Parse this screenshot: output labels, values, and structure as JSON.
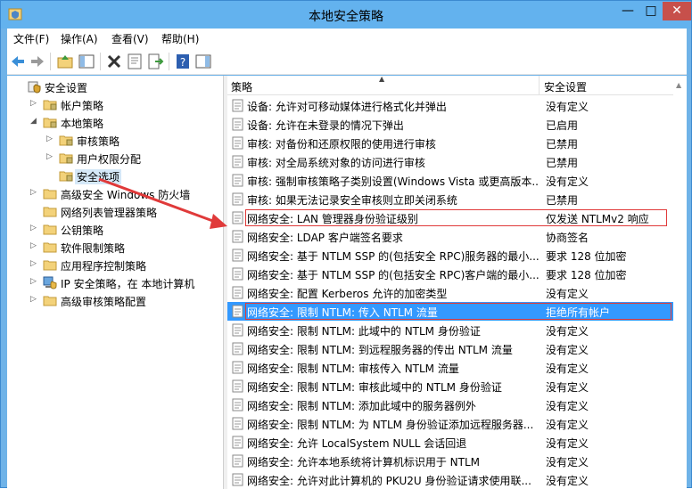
{
  "window": {
    "title": "本地安全策略"
  },
  "menu": [
    "文件(F)",
    "操作(A)",
    "查看(V)",
    "帮助(H)"
  ],
  "tree": [
    {
      "label": "安全设置",
      "level": 0,
      "twisty": "",
      "icon": "folder-shield-icon"
    },
    {
      "label": "帐户策略",
      "level": 1,
      "twisty": "▷",
      "icon": "folder-icon"
    },
    {
      "label": "本地策略",
      "level": 1,
      "twisty": "◢",
      "icon": "folder-icon"
    },
    {
      "label": "审核策略",
      "level": 2,
      "twisty": "▷",
      "icon": "folder-icon"
    },
    {
      "label": "用户权限分配",
      "level": 2,
      "twisty": "▷",
      "icon": "folder-icon"
    },
    {
      "label": "安全选项",
      "level": 2,
      "twisty": "",
      "icon": "folder-icon",
      "selected": true
    },
    {
      "label": "高级安全 Windows 防火墙",
      "level": 1,
      "twisty": "▷",
      "icon": "folder-icon"
    },
    {
      "label": "网络列表管理器策略",
      "level": 1,
      "twisty": "",
      "icon": "folder-icon"
    },
    {
      "label": "公钥策略",
      "level": 1,
      "twisty": "▷",
      "icon": "folder-icon"
    },
    {
      "label": "软件限制策略",
      "level": 1,
      "twisty": "▷",
      "icon": "folder-icon"
    },
    {
      "label": "应用程序控制策略",
      "level": 1,
      "twisty": "▷",
      "icon": "folder-icon"
    },
    {
      "label": "IP 安全策略，在 本地计算机",
      "level": 1,
      "twisty": "▷",
      "icon": "ip-security-icon"
    },
    {
      "label": "高级审核策略配置",
      "level": 1,
      "twisty": "▷",
      "icon": "folder-icon"
    }
  ],
  "list": {
    "columns": [
      "策略",
      "安全设置"
    ],
    "rows": [
      {
        "policy": "设备: 允许对可移动媒体进行格式化并弹出",
        "setting": "没有定义"
      },
      {
        "policy": "设备: 允许在未登录的情况下弹出",
        "setting": "已启用"
      },
      {
        "policy": "审核: 对备份和还原权限的使用进行审核",
        "setting": "已禁用"
      },
      {
        "policy": "审核: 对全局系统对象的访问进行审核",
        "setting": "已禁用"
      },
      {
        "policy": "审核: 强制审核策略子类别设置(Windows Vista 或更高版本...",
        "setting": "没有定义"
      },
      {
        "policy": "审核: 如果无法记录安全审核则立即关闭系统",
        "setting": "已禁用"
      },
      {
        "policy": "网络安全: LAN 管理器身份验证级别",
        "setting": "仅发送 NTLMv2 响应",
        "boxed": true
      },
      {
        "policy": "网络安全: LDAP 客户端签名要求",
        "setting": "协商签名"
      },
      {
        "policy": "网络安全: 基于 NTLM SSP 的(包括安全 RPC)服务器的最小...",
        "setting": "要求 128 位加密"
      },
      {
        "policy": "网络安全: 基于 NTLM SSP 的(包括安全 RPC)客户端的最小...",
        "setting": "要求 128 位加密"
      },
      {
        "policy": "网络安全: 配置 Kerberos 允许的加密类型",
        "setting": "没有定义"
      },
      {
        "policy": "网络安全: 限制 NTLM: 传入 NTLM 流量",
        "setting": "拒绝所有帐户",
        "selected": true,
        "boxed": true
      },
      {
        "policy": "网络安全: 限制 NTLM: 此域中的 NTLM 身份验证",
        "setting": "没有定义"
      },
      {
        "policy": "网络安全: 限制 NTLM: 到远程服务器的传出 NTLM 流量",
        "setting": "没有定义"
      },
      {
        "policy": "网络安全: 限制 NTLM: 审核传入 NTLM 流量",
        "setting": "没有定义"
      },
      {
        "policy": "网络安全: 限制 NTLM: 审核此域中的 NTLM 身份验证",
        "setting": "没有定义"
      },
      {
        "policy": "网络安全: 限制 NTLM: 添加此域中的服务器例外",
        "setting": "没有定义"
      },
      {
        "policy": "网络安全: 限制 NTLM: 为 NTLM 身份验证添加远程服务器...",
        "setting": "没有定义"
      },
      {
        "policy": "网络安全: 允许 LocalSystem NULL 会话回退",
        "setting": "没有定义"
      },
      {
        "policy": "网络安全: 允许本地系统将计算机标识用于 NTLM",
        "setting": "没有定义"
      },
      {
        "policy": "网络安全: 允许对此计算机的 PKU2U 身份验证请求使用联...",
        "setting": "没有定义"
      }
    ]
  },
  "colors": {
    "titlebar": "#63b2ee",
    "selection": "#3399ff",
    "annotation": "#e03a3a",
    "close": "#c7504b"
  }
}
